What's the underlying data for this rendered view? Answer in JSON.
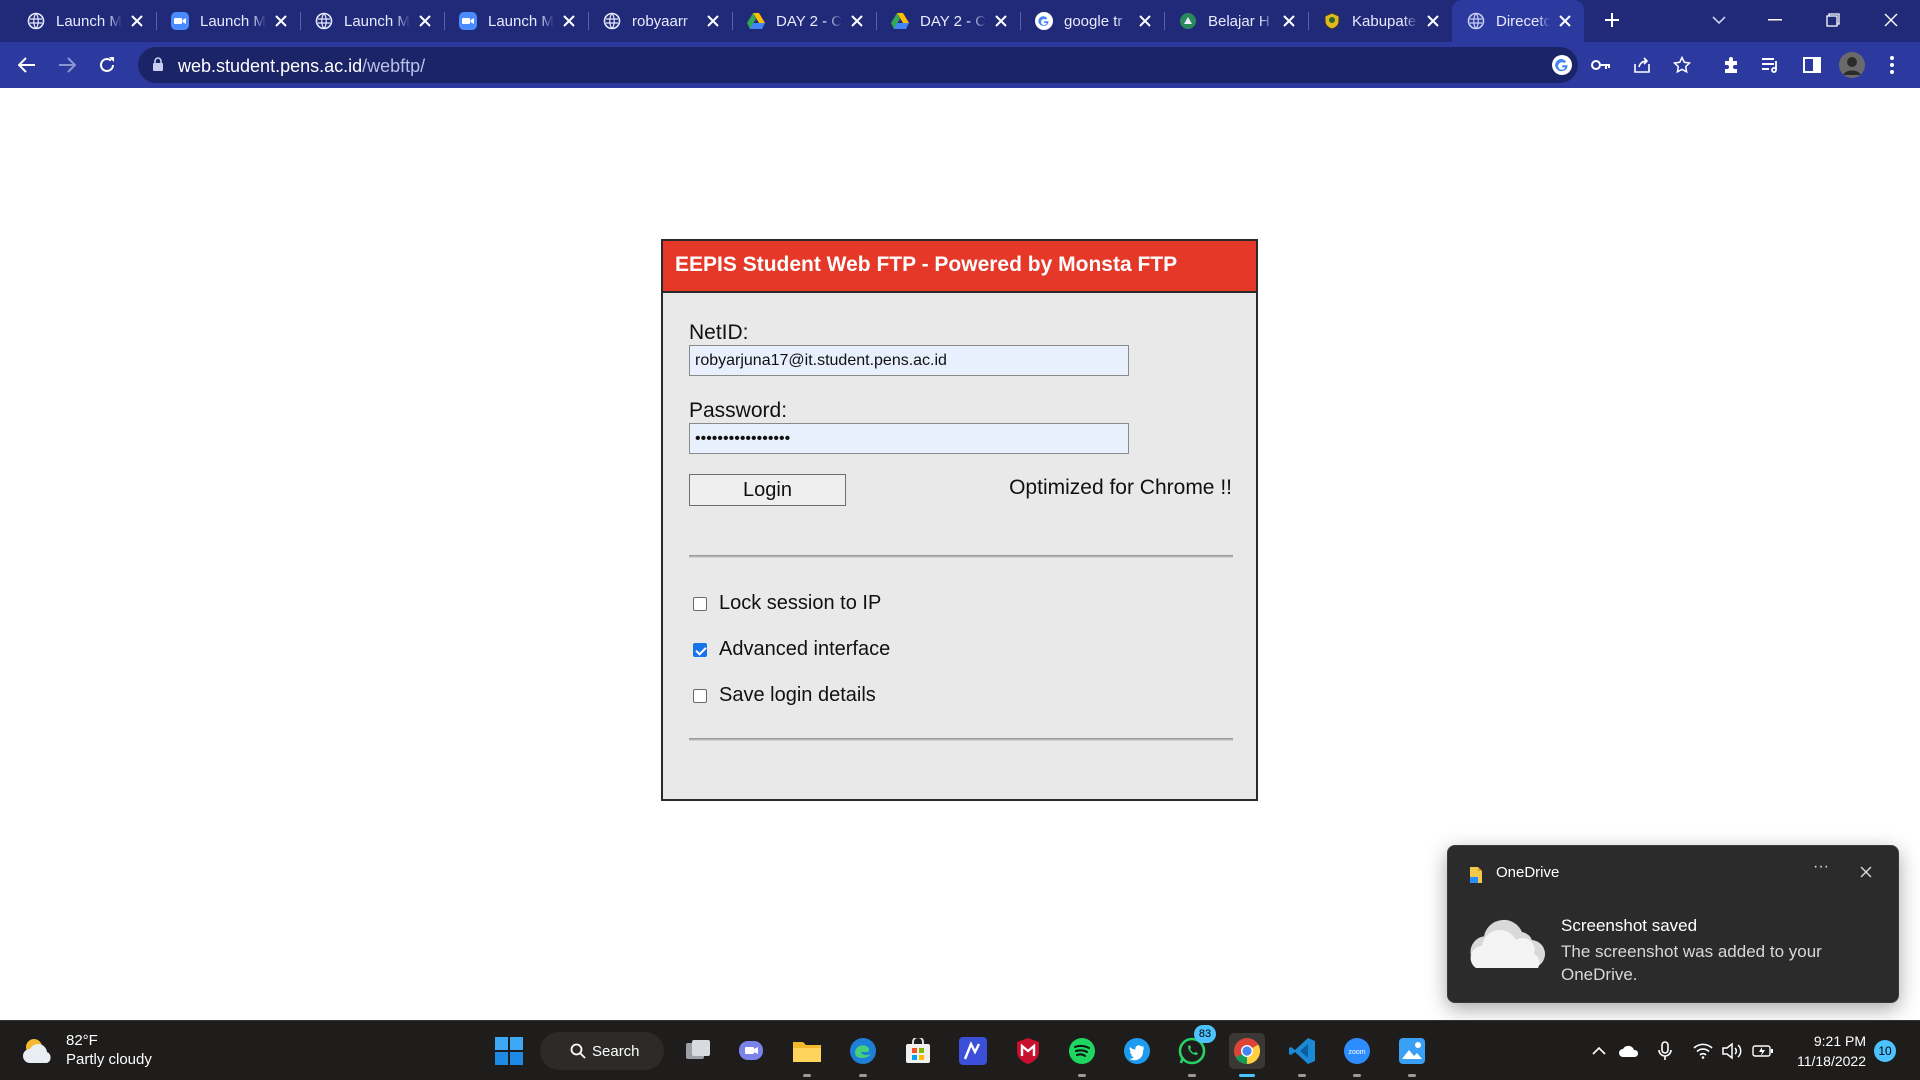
{
  "browser": {
    "tabs": [
      {
        "label": "Launch M",
        "icon": "globe-icon"
      },
      {
        "label": "Launch M",
        "icon": "zoom-icon"
      },
      {
        "label": "Launch M",
        "icon": "globe-icon"
      },
      {
        "label": "Launch M",
        "icon": "zoom-icon"
      },
      {
        "label": "robyaarr",
        "icon": "globe-icon"
      },
      {
        "label": "DAY 2 - C",
        "icon": "google-drive-icon"
      },
      {
        "label": "DAY 2 - C",
        "icon": "google-drive-icon"
      },
      {
        "label": "google tr",
        "icon": "google-icon"
      },
      {
        "label": "Belajar H",
        "icon": "site-icon"
      },
      {
        "label": "Kabupate",
        "icon": "shield-site-icon"
      },
      {
        "label": "Direcetor",
        "icon": "globe-icon",
        "active": true
      }
    ],
    "url_host": "web.student.pens.ac.id",
    "url_path": "/webftp/",
    "colors": {
      "tab_strip": "#202a78",
      "toolbar": "#2c3aa0"
    }
  },
  "ftp": {
    "header": "EEPIS Student Web FTP - Powered by Monsta FTP",
    "netid_label": "NetID:",
    "netid_value": "robyarjuna17@it.student.pens.ac.id",
    "password_label": "Password:",
    "password_value": "•••••••••••••••••",
    "login_button": "Login",
    "optimized_note": "Optimized for Chrome !!",
    "options": [
      {
        "label": "Lock session to IP",
        "checked": false
      },
      {
        "label": "Advanced interface",
        "checked": true
      },
      {
        "label": "Save login details",
        "checked": false
      }
    ],
    "colors": {
      "header_bg": "#e53829",
      "panel_bg": "#e9e9e9"
    }
  },
  "notification": {
    "app": "OneDrive",
    "more": "···",
    "title": "Screenshot saved",
    "body": "The screenshot was added to your OneDrive."
  },
  "taskbar": {
    "weather_temp": "82°F",
    "weather_desc": "Partly cloudy",
    "search_label": "Search",
    "whatsapp_badge": "83",
    "time": "9:21 PM",
    "date": "11/18/2022",
    "notification_count": "10"
  }
}
